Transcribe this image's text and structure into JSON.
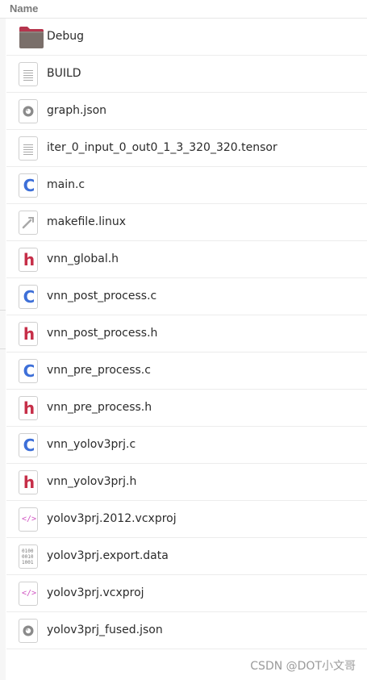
{
  "header": {
    "name_label": "Name"
  },
  "files": [
    {
      "name": "Debug",
      "icon": "folder-icon"
    },
    {
      "name": "BUILD",
      "icon": "text-file-icon"
    },
    {
      "name": "graph.json",
      "icon": "json-file-icon"
    },
    {
      "name": "iter_0_input_0_out0_1_3_320_320.tensor",
      "icon": "text-file-icon"
    },
    {
      "name": "main.c",
      "icon": "c-source-icon"
    },
    {
      "name": "makefile.linux",
      "icon": "makefile-icon"
    },
    {
      "name": "vnn_global.h",
      "icon": "c-header-icon"
    },
    {
      "name": "vnn_post_process.c",
      "icon": "c-source-icon"
    },
    {
      "name": "vnn_post_process.h",
      "icon": "c-header-icon"
    },
    {
      "name": "vnn_pre_process.c",
      "icon": "c-source-icon"
    },
    {
      "name": "vnn_pre_process.h",
      "icon": "c-header-icon"
    },
    {
      "name": "vnn_yolov3prj.c",
      "icon": "c-source-icon"
    },
    {
      "name": "vnn_yolov3prj.h",
      "icon": "c-header-icon"
    },
    {
      "name": "yolov3prj.2012.vcxproj",
      "icon": "xml-file-icon"
    },
    {
      "name": "yolov3prj.export.data",
      "icon": "binary-file-icon"
    },
    {
      "name": "yolov3prj.vcxproj",
      "icon": "xml-file-icon"
    },
    {
      "name": "yolov3prj_fused.json",
      "icon": "json-file-icon"
    }
  ],
  "icon_text": {
    "c": "C",
    "h": "h",
    "xml": "</>",
    "bin": "0100\n0010\n1001"
  },
  "watermark": "CSDN @DOT小文哥",
  "colors": {
    "folder": "#7a6f6a",
    "folder_tab": "#b5354d",
    "c_glyph": "#3d6fd8",
    "h_glyph": "#c62e48",
    "xml_glyph": "#d054c2",
    "row_divider": "#ececec"
  }
}
